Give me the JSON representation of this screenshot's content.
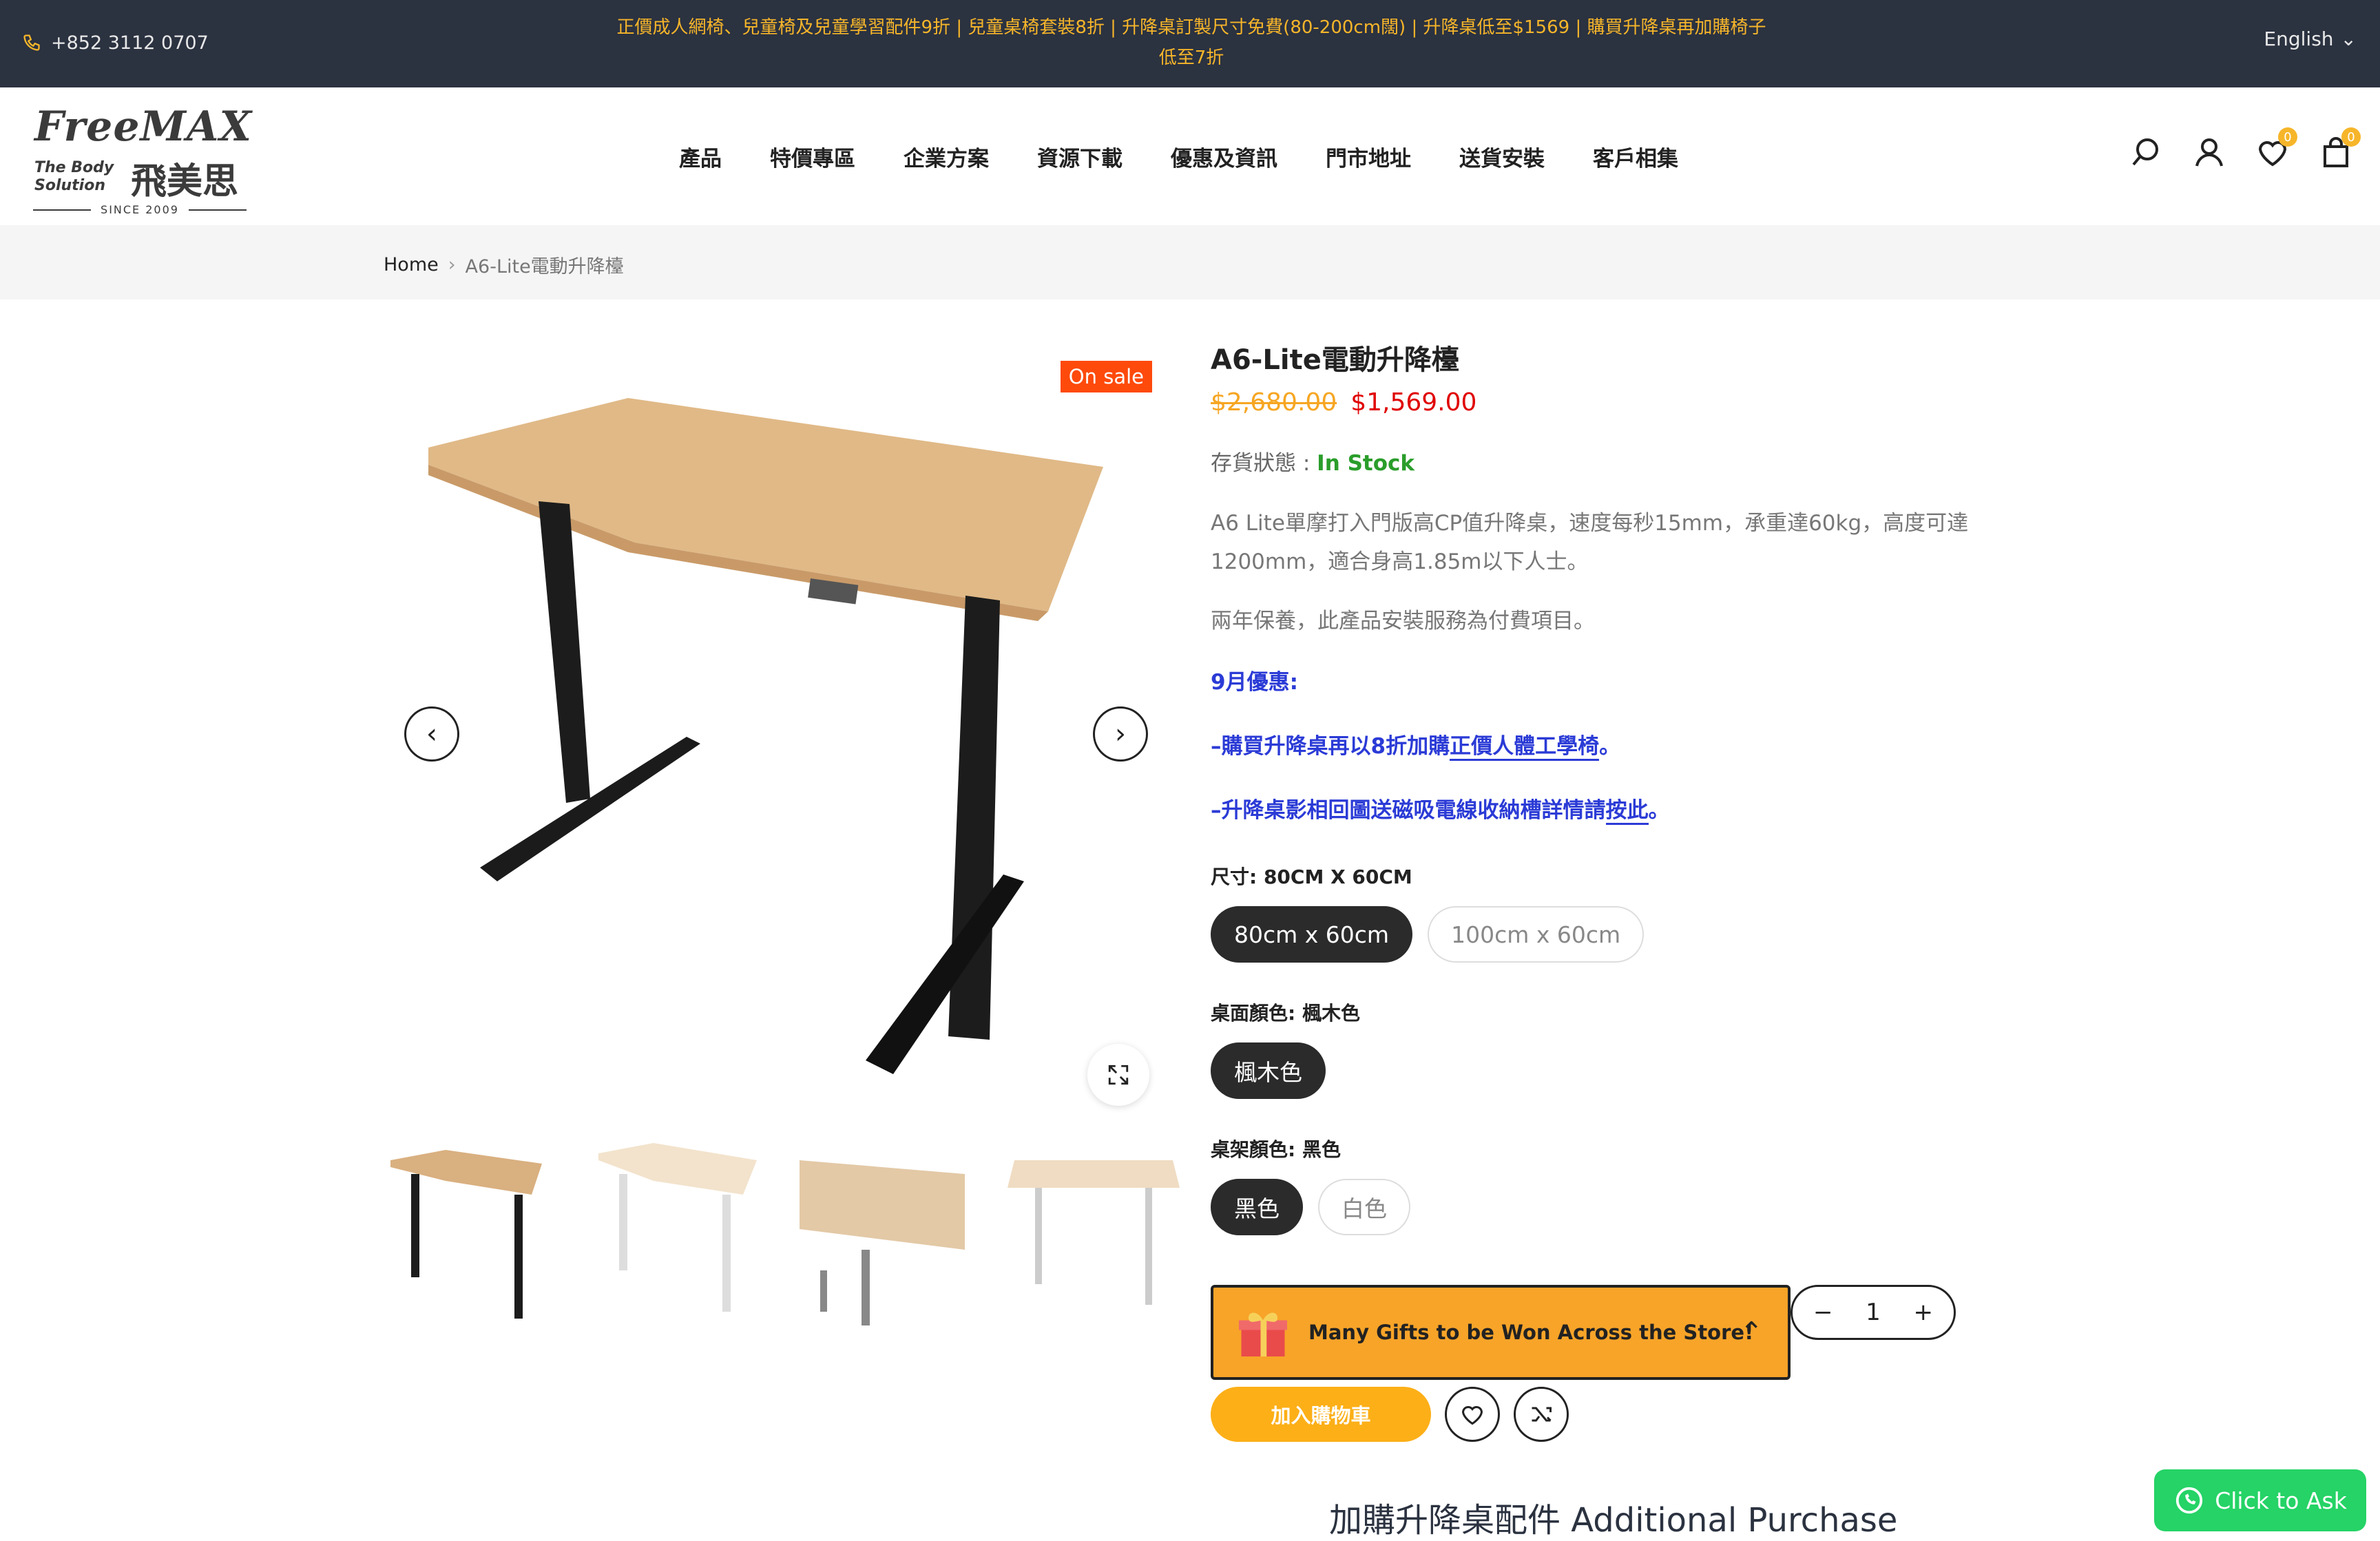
{
  "topbar": {
    "phone": "+852 3112 0707",
    "announcement_line1": "正價成人網椅、兒童椅及兒童學習配件9折 | 兒童桌椅套裝8折 | 升降桌訂製尺寸免費(80-200cm闊) | 升降桌低至$1569 | 購買升降桌再加購椅子",
    "announcement_line2": "低至7折",
    "language": "English"
  },
  "logo": {
    "main": "FreeMAX",
    "sub1": "The Body",
    "sub2": "Solution",
    "cn": "飛美思",
    "since": "SINCE 2009"
  },
  "nav": [
    "產品",
    "特價專區",
    "企業方案",
    "資源下載",
    "優惠及資訊",
    "門市地址",
    "送貨安裝",
    "客戶相集"
  ],
  "header_icons": {
    "wishlist_count": "0",
    "cart_count": "0"
  },
  "breadcrumb": {
    "home": "Home",
    "current": "A6-Lite電動升降檯"
  },
  "gallery": {
    "badge": "On sale"
  },
  "product": {
    "title": "A6-Lite電動升降檯",
    "old_price": "$2,680.00",
    "new_price": "$1,569.00",
    "stock_label": "存貨狀態 :",
    "stock_value": "In Stock",
    "desc_line1": "A6 Lite單摩打入門版高CP值升降桌，速度每秒15mm，承重達60kg，高度可達",
    "desc_line2": "1200mm，適合身高1.85m以下人士。",
    "desc2": "兩年保養，此產品安裝服務為付費項目。",
    "promo_title": "9月優惠:",
    "promo1_pre": "–購買升降桌再以8折加購",
    "promo1_link": "正價人體工學椅",
    "promo1_post": "。",
    "promo2_pre": "–升降桌影相回圖送磁吸電線收納槽詳情請",
    "promo2_link": "按此",
    "promo2_post": "。",
    "size_label": "尺寸: 80CM X 60CM",
    "sizes": [
      "80cm x 60cm",
      "100cm x 60cm"
    ],
    "top_color_label": "桌面顏色: 楓木色",
    "top_colors": [
      "楓木色"
    ],
    "frame_color_label": "桌架顏色: 黑色",
    "frame_colors": [
      "黑色",
      "白色"
    ],
    "gift_text": "Many Gifts to be Won Across the Store!",
    "qty": "1",
    "add_to_cart": "加入購物車",
    "additional_purchase": "加購升降桌配件 Additional Purchase"
  },
  "whatsapp": {
    "label": "Click to Ask"
  },
  "colors": {
    "topbar_bg": "#2b3240",
    "accent_orange": "#f6b52a",
    "sale_badge": "#fe4a0b",
    "price_red": "#e00000",
    "in_stock_green": "#2a9d2a",
    "promo_blue": "#2b3bd6",
    "whatsapp_green": "#25d366"
  }
}
